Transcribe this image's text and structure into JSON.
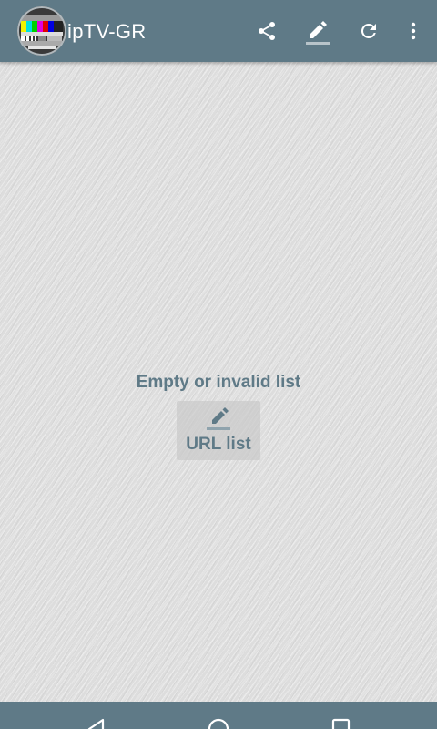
{
  "app": {
    "title": "ipTV-GR",
    "logo_icon": "test-card-logo-icon"
  },
  "toolbar": {
    "actions": [
      "share-icon",
      "edit-icon",
      "refresh-icon",
      "more-vert-icon"
    ]
  },
  "main": {
    "empty_message": "Empty or invalid list",
    "url_list_button_label": "URL list",
    "url_list_button_icon": "edit-icon"
  },
  "navbar": {
    "buttons": [
      "back-icon",
      "home-icon",
      "recents-icon"
    ]
  },
  "colors": {
    "appbar": "#5f7a87",
    "accent_text": "#5f7a87",
    "background": "#dddddd"
  }
}
